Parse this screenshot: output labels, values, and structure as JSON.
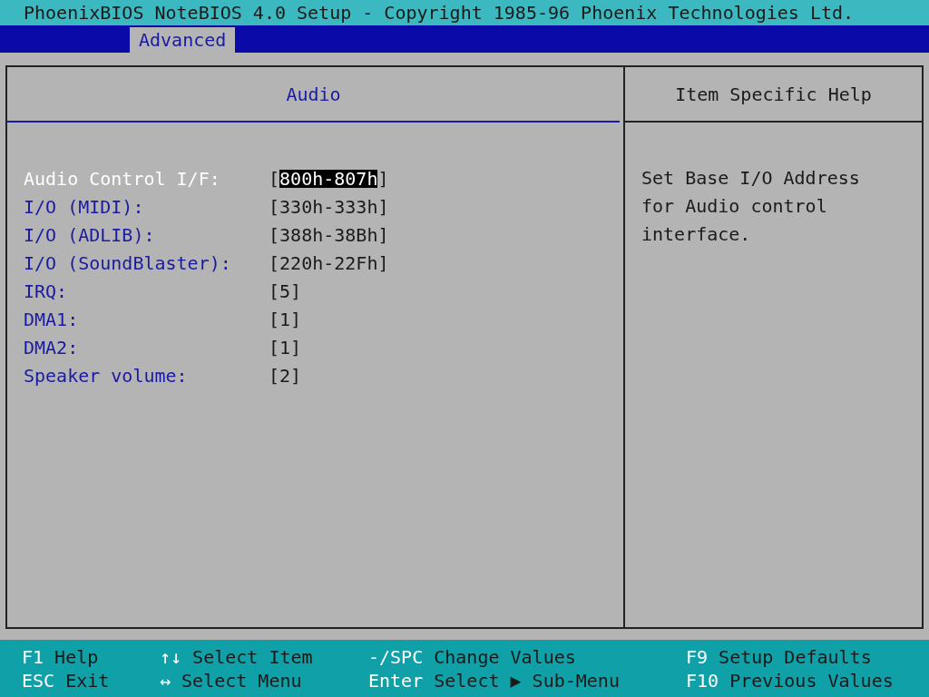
{
  "title_bar": "PhoenixBIOS NoteBIOS 4.0 Setup - Copyright 1985-96 Phoenix Technologies Ltd.",
  "tabs": [
    {
      "label": "Advanced",
      "selected": true
    }
  ],
  "panel": {
    "title": "Audio",
    "settings": [
      {
        "label": "Audio Control I/F:",
        "open": "[",
        "value": "800h-807h",
        "close": "]",
        "selected": true
      },
      {
        "label": "I/O (MIDI):",
        "open": "[",
        "value": "330h-333h",
        "close": "]",
        "selected": false
      },
      {
        "label": "I/O (ADLIB):",
        "open": "[",
        "value": "388h-38Bh",
        "close": "]",
        "selected": false
      },
      {
        "label": "I/O (SoundBlaster):",
        "open": "[",
        "value": "220h-22Fh",
        "close": "]",
        "selected": false
      },
      {
        "label": "IRQ:",
        "open": "[",
        "value": "5",
        "close": "]",
        "selected": false
      },
      {
        "label": "DMA1:",
        "open": "[",
        "value": "1",
        "close": "]",
        "selected": false
      },
      {
        "label": "DMA2:",
        "open": "[",
        "value": "1",
        "close": "]",
        "selected": false
      },
      {
        "label": "Speaker volume:",
        "open": "[",
        "value": "2",
        "close": "]",
        "selected": false
      }
    ]
  },
  "help": {
    "title": "Item Specific Help",
    "text": "Set Base I/O Address for Audio control interface."
  },
  "key_legend": [
    {
      "key": "F1",
      "action": "Help"
    },
    {
      "key": "↑↓",
      "action": "Select Item"
    },
    {
      "key": "-/SPC",
      "action": "Change Values"
    },
    {
      "key": "F9",
      "action": "Setup Defaults"
    },
    {
      "key": "ESC",
      "action": "Exit"
    },
    {
      "key": "↔",
      "action": "Select Menu"
    },
    {
      "key": "Enter",
      "action": "Select ▶ Sub-Menu"
    },
    {
      "key": "F10",
      "action": "Previous Values"
    }
  ]
}
